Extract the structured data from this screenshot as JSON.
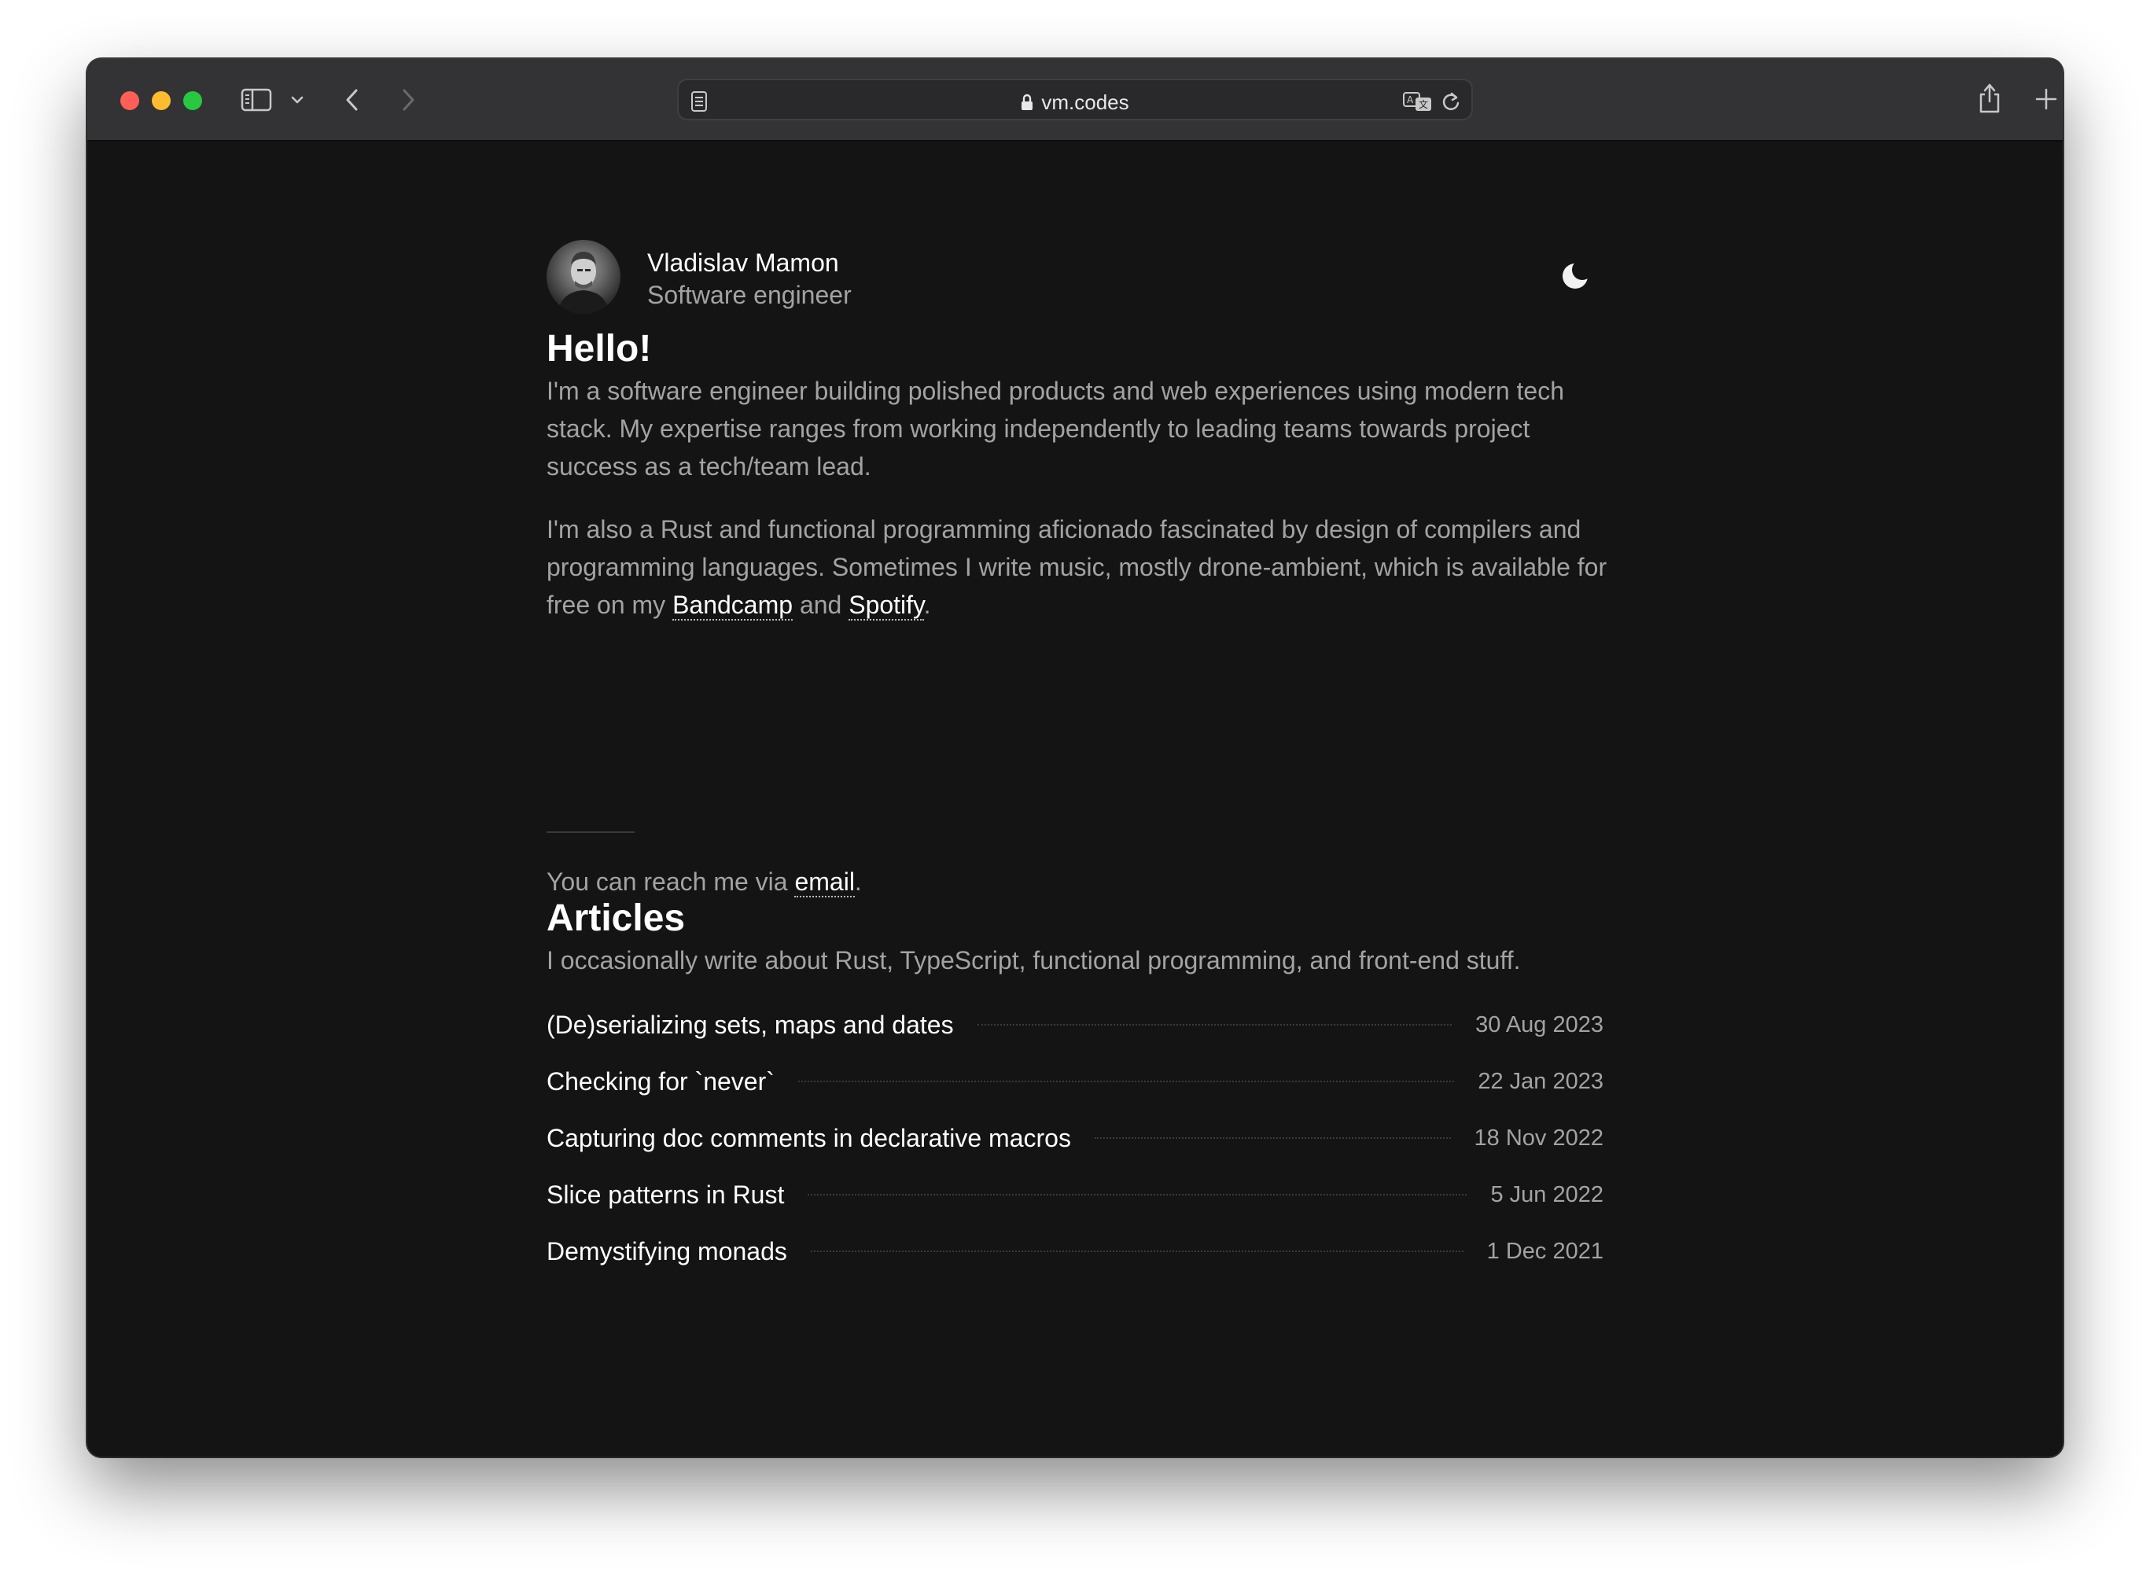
{
  "browser": {
    "url": "vm.codes",
    "colors": {
      "close": "#ff5f57",
      "minimize": "#febc2e",
      "zoom": "#28c840",
      "page_bg": "#141414"
    }
  },
  "profile": {
    "name": "Vladislav Mamon",
    "title": "Software engineer"
  },
  "hello": {
    "heading": "Hello!",
    "p1": "I'm a software engineer building polished products and web experiences using modern tech stack. My expertise ranges from working independently to leading teams towards project success as a tech/team lead.",
    "p2_before": "I'm also a Rust and functional programming aficionado fascinated by design of compilers and programming languages. Sometimes I write music, mostly drone-ambient, which is available for free on my ",
    "bandcamp": "Bandcamp",
    "and": " and ",
    "spotify": "Spotify",
    "p2_end": ".",
    "reach_before": "You can reach me via ",
    "email": "email",
    "reach_end": "."
  },
  "articles": {
    "heading": "Articles",
    "intro": "I occasionally write about Rust, TypeScript, functional programming, and front-end stuff.",
    "items": [
      {
        "title": "(De)serializing sets, maps and dates",
        "date": "30 Aug 2023"
      },
      {
        "title": "Checking for `never`",
        "date": "22 Jan 2023"
      },
      {
        "title": "Capturing doc comments in declarative macros",
        "date": "18 Nov 2022"
      },
      {
        "title": "Slice patterns in Rust",
        "date": "5 Jun 2022"
      },
      {
        "title": "Demystifying monads",
        "date": "1 Dec 2021"
      }
    ]
  }
}
